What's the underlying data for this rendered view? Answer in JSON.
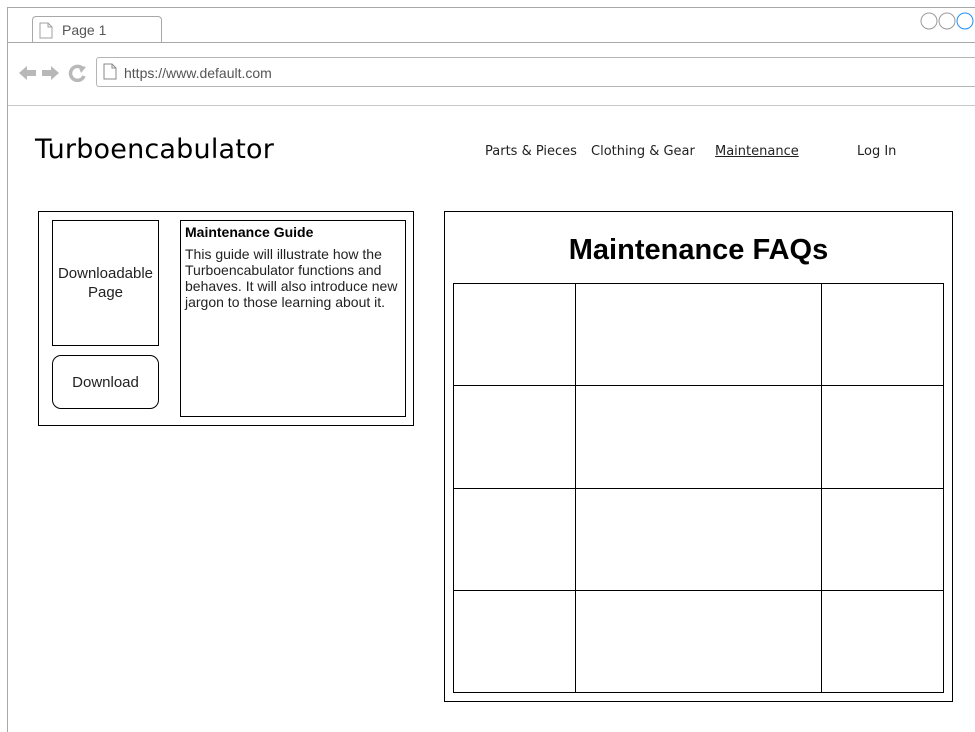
{
  "browser": {
    "tab_title": "Page 1",
    "url": "https://www.default.com"
  },
  "site": {
    "title": "Turboencabulator"
  },
  "nav": {
    "items": [
      {
        "label": "Parts & Pieces",
        "active": false
      },
      {
        "label": "Clothing & Gear",
        "active": false
      },
      {
        "label": "Maintenance",
        "active": true
      }
    ],
    "login_label": "Log In"
  },
  "guide": {
    "thumbnail_label": "Downloadable Page",
    "download_label": "Download",
    "heading": "Maintenance Guide",
    "body": "This guide will illustrate how the Turboencabulator functions and behaves. It will also introduce new jargon to those learning about it."
  },
  "faq": {
    "title": "Maintenance FAQs",
    "rows": [
      [
        "",
        "",
        ""
      ],
      [
        "",
        "",
        ""
      ],
      [
        "",
        "",
        ""
      ],
      [
        "",
        "",
        ""
      ]
    ]
  }
}
